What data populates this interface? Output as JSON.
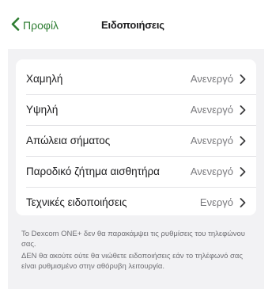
{
  "nav": {
    "back_label": "Προφίλ",
    "title": "Ειδοποιήσεις"
  },
  "settings": {
    "rows": [
      {
        "label": "Χαμηλή",
        "value": "Ανενεργό"
      },
      {
        "label": "Υψηλή",
        "value": "Ανενεργό"
      },
      {
        "label": "Απώλεια σήματος",
        "value": "Ανενεργό"
      },
      {
        "label": "Παροδικό ζήτημα αισθητήρα",
        "value": "Ανενεργό"
      },
      {
        "label": "Τεχνικές ειδοποιήσεις",
        "value": "Ενεργό"
      }
    ]
  },
  "footer": {
    "line1": "Το Dexcom ONE+ δεν θα παρακάμψει τις ρυθμίσεις του τηλεφώνου σας.",
    "line2": "ΔΕΝ θα ακούτε ούτε θα νιώθετε ειδοποιήσεις εάν το τηλέφωνό σας είναι ρυθμισμένο στην αθόρυβη λειτουργία."
  },
  "colors": {
    "accent": "#2e7d32",
    "background": "#f2f2f4",
    "card": "#ffffff",
    "secondary_text": "#7a7a7e"
  },
  "icons": {
    "back": "chevron-left-icon",
    "row": "chevron-right-icon"
  }
}
